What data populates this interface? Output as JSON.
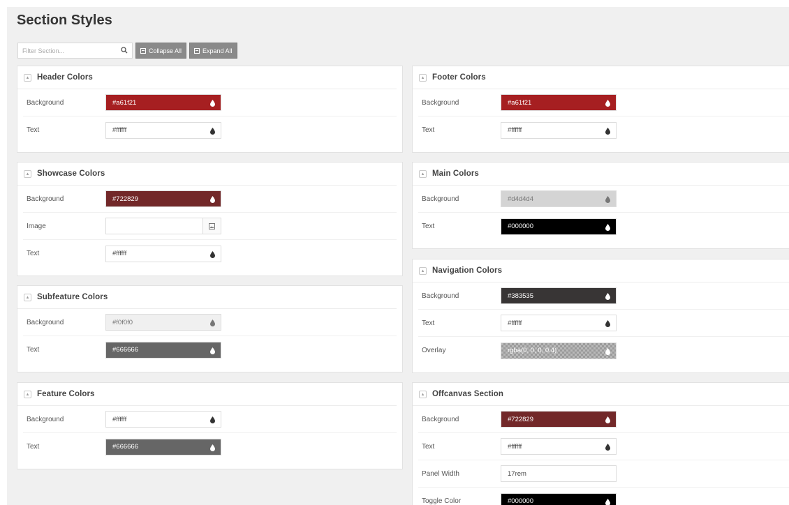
{
  "page": {
    "title": "Section Styles"
  },
  "toolbar": {
    "filter_placeholder": "Filter Section...",
    "collapse_all": "Collapse All",
    "expand_all": "Expand All"
  },
  "icons": {
    "search": "search-icon",
    "toggle": "collapse-toggle-icon",
    "drop": "color-drop-icon",
    "image": "image-picker-icon"
  },
  "sections": {
    "header": {
      "title": "Header Colors",
      "rows": [
        {
          "label": "Background",
          "value": "#a61f21",
          "color": "#a61f21"
        },
        {
          "label": "Text",
          "value": "#ffffff",
          "color": "#ffffff"
        }
      ]
    },
    "showcase": {
      "title": "Showcase Colors",
      "rows": [
        {
          "label": "Background",
          "value": "#722829",
          "color": "#722829"
        },
        {
          "label": "Image",
          "value": ""
        },
        {
          "label": "Text",
          "value": "#ffffff",
          "color": "#ffffff"
        }
      ]
    },
    "subfeature": {
      "title": "Subfeature Colors",
      "rows": [
        {
          "label": "Background",
          "value": "#f0f0f0",
          "color": "#f0f0f0"
        },
        {
          "label": "Text",
          "value": "#666666",
          "color": "#666666"
        }
      ]
    },
    "feature": {
      "title": "Feature Colors",
      "rows": [
        {
          "label": "Background",
          "value": "#ffffff",
          "color": "#ffffff"
        },
        {
          "label": "Text",
          "value": "#666666",
          "color": "#666666"
        }
      ]
    },
    "footer": {
      "title": "Footer Colors",
      "rows": [
        {
          "label": "Background",
          "value": "#a61f21",
          "color": "#a61f21"
        },
        {
          "label": "Text",
          "value": "#ffffff",
          "color": "#ffffff"
        }
      ]
    },
    "main": {
      "title": "Main Colors",
      "rows": [
        {
          "label": "Background",
          "value": "#d4d4d4",
          "color": "#d4d4d4"
        },
        {
          "label": "Text",
          "value": "#000000",
          "color": "#000000"
        }
      ]
    },
    "navigation": {
      "title": "Navigation Colors",
      "rows": [
        {
          "label": "Background",
          "value": "#383535",
          "color": "#383535"
        },
        {
          "label": "Text",
          "value": "#ffffff",
          "color": "#ffffff"
        },
        {
          "label": "Overlay",
          "value": "rgba(0, 0, 0, 0.4)",
          "color": "rgba(0, 0, 0, 0.4)"
        }
      ]
    },
    "offcanvas": {
      "title": "Offcanvas Section",
      "rows": [
        {
          "label": "Background",
          "value": "#722829",
          "color": "#722829"
        },
        {
          "label": "Text",
          "value": "#ffffff",
          "color": "#ffffff"
        },
        {
          "label": "Panel Width",
          "value": "17rem"
        },
        {
          "label": "Toggle Color",
          "value": "#000000",
          "color": "#000000"
        }
      ]
    }
  }
}
